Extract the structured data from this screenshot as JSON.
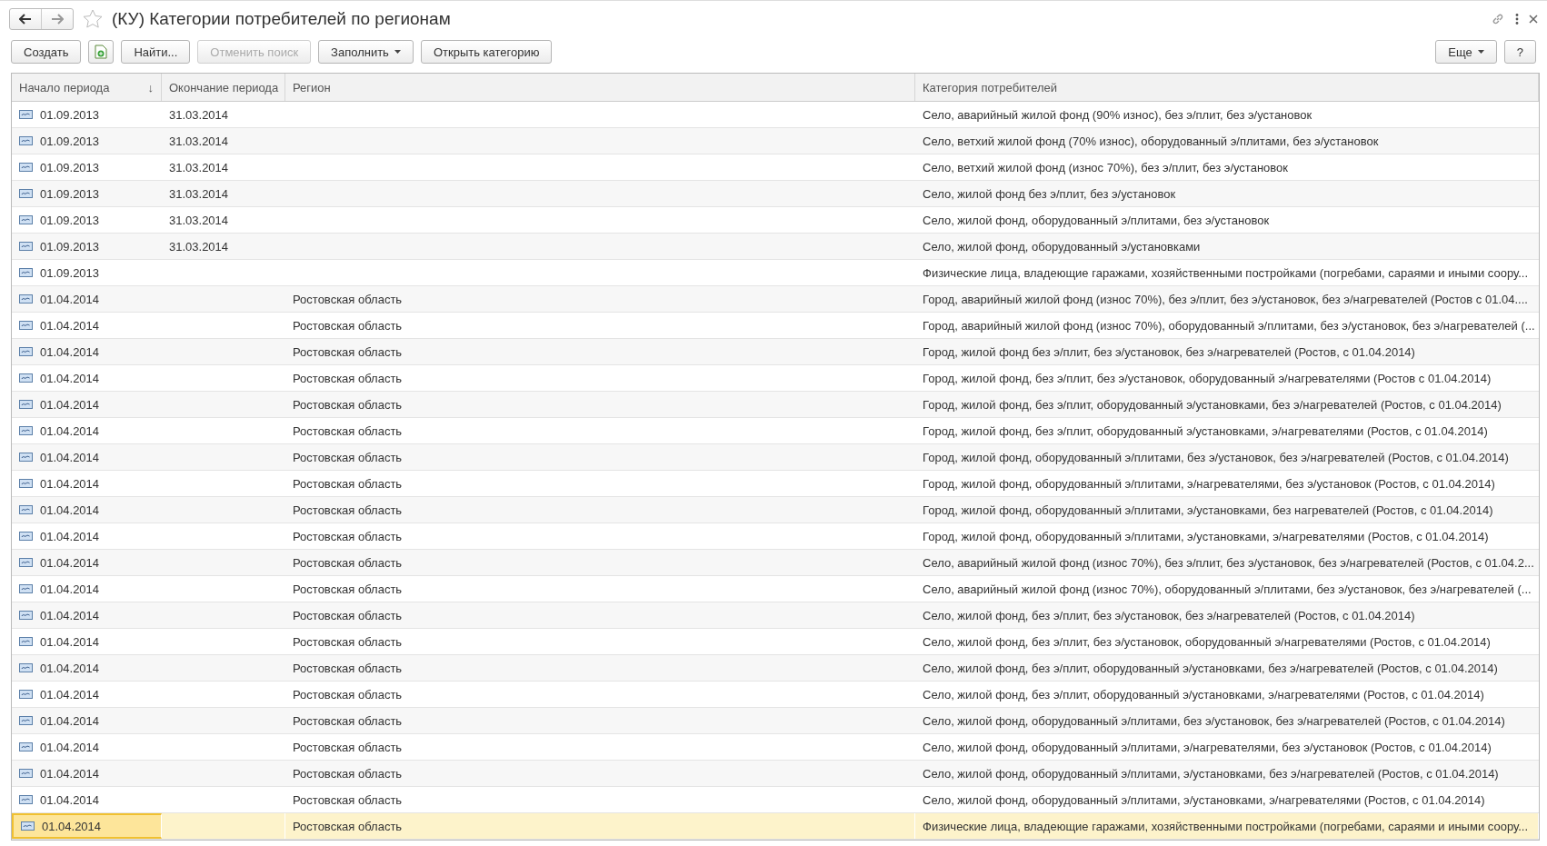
{
  "window": {
    "title": "(КУ) Категории потребителей по регионам",
    "favorite": false
  },
  "toolbar": {
    "buttons": [
      {
        "kind": "text",
        "label": "Создать",
        "disabled": false
      },
      {
        "kind": "icon",
        "disabled": false
      },
      {
        "kind": "text",
        "label": "Найти...",
        "disabled": false
      },
      {
        "kind": "text",
        "label": "Отменить поиск",
        "disabled": true
      },
      {
        "kind": "dropdown",
        "label": "Заполнить",
        "disabled": false
      },
      {
        "kind": "text",
        "label": "Открыть категорию",
        "disabled": false
      }
    ],
    "right_buttons": [
      {
        "kind": "dropdown",
        "label": "Еще",
        "disabled": false
      },
      {
        "kind": "text",
        "label": "?",
        "disabled": false
      }
    ]
  },
  "table": {
    "columns": [
      {
        "label": "Начало периода",
        "sort_mark": "↓"
      },
      {
        "label": "Окончание периода"
      },
      {
        "label": "Регион"
      },
      {
        "label": "Категория потребителей"
      }
    ],
    "rows": [
      {
        "start": "01.09.2013",
        "end": "31.03.2014",
        "region": "",
        "category": "Село, аварийный жилой фонд (90% износ), без э/плит, без э/установок",
        "selected": false
      },
      {
        "start": "01.09.2013",
        "end": "31.03.2014",
        "region": "",
        "category": "Село, ветхий жилой фонд (70% износ), оборудованный э/плитами, без э/установок",
        "selected": false
      },
      {
        "start": "01.09.2013",
        "end": "31.03.2014",
        "region": "",
        "category": "Село, ветхий жилой фонд (износ 70%), без э/плит, без э/установок",
        "selected": false
      },
      {
        "start": "01.09.2013",
        "end": "31.03.2014",
        "region": "",
        "category": "Село, жилой фонд без э/плит, без э/установок",
        "selected": false
      },
      {
        "start": "01.09.2013",
        "end": "31.03.2014",
        "region": "",
        "category": "Село, жилой фонд, оборудованный э/плитами, без э/установок",
        "selected": false
      },
      {
        "start": "01.09.2013",
        "end": "31.03.2014",
        "region": "",
        "category": "Село, жилой фонд, оборудованный э/установками",
        "selected": false
      },
      {
        "start": "01.09.2013",
        "end": "",
        "region": "",
        "category": "Физические лица, владеющие гаражами, хозяйственными постройками (погребами, сараями и иными соору...",
        "selected": false
      },
      {
        "start": "01.04.2014",
        "end": "",
        "region": "Ростовская область",
        "category": "Город, аварийный жилой фонд (износ 70%), без э/плит, без э/установок, без э/нагревателей (Ростов с 01.04....",
        "selected": false
      },
      {
        "start": "01.04.2014",
        "end": "",
        "region": "Ростовская область",
        "category": "Город, аварийный жилой фонд (износ 70%), оборудованный э/плитами, без э/установок, без э/нагревателей (...",
        "selected": false
      },
      {
        "start": "01.04.2014",
        "end": "",
        "region": "Ростовская область",
        "category": "Город, жилой фонд без э/плит, без э/установок, без э/нагревателей (Ростов, с 01.04.2014)",
        "selected": false
      },
      {
        "start": "01.04.2014",
        "end": "",
        "region": "Ростовская область",
        "category": "Город, жилой фонд, без э/плит, без э/установок, оборудованный э/нагревателями (Ростов с 01.04.2014)",
        "selected": false
      },
      {
        "start": "01.04.2014",
        "end": "",
        "region": "Ростовская область",
        "category": "Город, жилой фонд, без э/плит, оборудованный э/установками, без э/нагревателей (Ростов, с 01.04.2014)",
        "selected": false
      },
      {
        "start": "01.04.2014",
        "end": "",
        "region": "Ростовская область",
        "category": "Город, жилой фонд, без э/плит, оборудованный э/установками, э/нагревателями (Ростов, с 01.04.2014)",
        "selected": false
      },
      {
        "start": "01.04.2014",
        "end": "",
        "region": "Ростовская область",
        "category": "Город, жилой фонд, оборудованный э/плитами, без э/установок, без э/нагревателей (Ростов, с 01.04.2014)",
        "selected": false
      },
      {
        "start": "01.04.2014",
        "end": "",
        "region": "Ростовская область",
        "category": "Город, жилой фонд, оборудованный э/плитами, э/нагревателями, без э/установок (Ростов, с 01.04.2014)",
        "selected": false
      },
      {
        "start": "01.04.2014",
        "end": "",
        "region": "Ростовская область",
        "category": "Город, жилой фонд, оборудованный э/плитами, э/установками, без нагревателей (Ростов, с 01.04.2014)",
        "selected": false
      },
      {
        "start": "01.04.2014",
        "end": "",
        "region": "Ростовская область",
        "category": "Город, жилой фонд, оборудованный э/плитами, э/установками, э/нагревателями (Ростов, с 01.04.2014)",
        "selected": false
      },
      {
        "start": "01.04.2014",
        "end": "",
        "region": "Ростовская область",
        "category": "Село, аварийный жилой фонд (износ 70%), без э/плит, без э/установок, без э/нагревателей (Ростов, с 01.04.2...",
        "selected": false
      },
      {
        "start": "01.04.2014",
        "end": "",
        "region": "Ростовская область",
        "category": "Село, аварийный жилой фонд (износ 70%), оборудованный э/плитами, без э/установок, без э/нагревателей (...",
        "selected": false
      },
      {
        "start": "01.04.2014",
        "end": "",
        "region": "Ростовская область",
        "category": "Село, жилой фонд, без э/плит, без э/установок, без э/нагревателей (Ростов, с 01.04.2014)",
        "selected": false
      },
      {
        "start": "01.04.2014",
        "end": "",
        "region": "Ростовская область",
        "category": "Село, жилой фонд, без э/плит, без э/установок, оборудованный э/нагревателями (Ростов, с 01.04.2014)",
        "selected": false
      },
      {
        "start": "01.04.2014",
        "end": "",
        "region": "Ростовская область",
        "category": "Село, жилой фонд, без э/плит, оборудованный э/установками, без э/нагревателей (Ростов, с 01.04.2014)",
        "selected": false
      },
      {
        "start": "01.04.2014",
        "end": "",
        "region": "Ростовская область",
        "category": "Село, жилой фонд, без э/плит, оборудованный э/установками, э/нагревателями (Ростов, с 01.04.2014)",
        "selected": false
      },
      {
        "start": "01.04.2014",
        "end": "",
        "region": "Ростовская область",
        "category": "Село, жилой фонд, оборудованный э/плитами, без э/установок, без э/нагревателей (Ростов, с 01.04.2014)",
        "selected": false
      },
      {
        "start": "01.04.2014",
        "end": "",
        "region": "Ростовская область",
        "category": "Село, жилой фонд, оборудованный э/плитами, э/нагревателями, без э/установок (Ростов, с 01.04.2014)",
        "selected": false
      },
      {
        "start": "01.04.2014",
        "end": "",
        "region": "Ростовская область",
        "category": "Село, жилой фонд, оборудованный э/плитами, э/установками, без э/нагревателей (Ростов, с 01.04.2014)",
        "selected": false
      },
      {
        "start": "01.04.2014",
        "end": "",
        "region": "Ростовская область",
        "category": "Село, жилой фонд, оборудованный э/плитами, э/установками, э/нагревателями (Ростов, с 01.04.2014)",
        "selected": false
      },
      {
        "start": "01.04.2014",
        "end": "",
        "region": "Ростовская область",
        "category": "Физические лица, владеющие гаражами, хозяйственными постройками (погребами, сараями и иными соору...",
        "selected": true
      }
    ]
  }
}
